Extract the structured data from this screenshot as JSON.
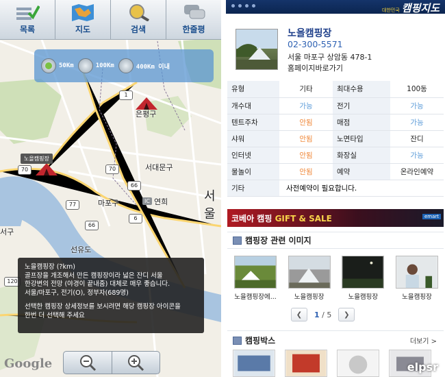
{
  "map_panel": {
    "toolbar": [
      {
        "label": "목록",
        "icon": "list-check-icon"
      },
      {
        "label": "지도",
        "icon": "map-icon"
      },
      {
        "label": "검색",
        "icon": "search-globe-icon"
      },
      {
        "label": "한줄평",
        "icon": "chat-bubbles-icon"
      }
    ],
    "radius_options": [
      {
        "label": "50Km",
        "selected": true
      },
      {
        "label": "100Km",
        "selected": false
      },
      {
        "label": "400Km 이내",
        "selected": false
      }
    ],
    "map_labels": {
      "eunpyeong": "은평구",
      "seodaemun": "서대문구",
      "mapo": "마포구",
      "yeonhui": "연희",
      "seoul": "서울",
      "seogu": "서구",
      "seonyu": "선유도",
      "ic": "IC",
      "road_1": "1",
      "road_70a": "70",
      "road_70b": "70",
      "road_66a": "66",
      "road_66b": "66",
      "road_77": "77",
      "road_6": "6",
      "road_120": "120"
    },
    "marker_tag": "노을캠핑장",
    "info_popup": {
      "line1": "노을캠핑장 (?km)\n골프장을 개조해서 만든 캠핑장이라 넓은 잔디 서울\n한강변의 전망 (야경이 끝내줌) 대체로 매우 좋습니다.\n서울/마포구, 전기(O), 정부자(689명)",
      "line2": "선택한 캠핑장 상세정보를 보시려면 해당 캠핑장 아이콘을\n한번 더 선택해 주세요"
    },
    "google_logo": "Google",
    "zoom": {
      "out_icon": "zoom-out-icon",
      "in_icon": "zoom-in-icon"
    }
  },
  "detail_panel": {
    "brand": {
      "small": "대한민국",
      "big": "캠핑지도"
    },
    "camp": {
      "name": "노을캠핑장",
      "phone": "02-300-5571",
      "address": "서울 마포구 상암동 478-1",
      "homepage": "홈페이지바로가기"
    },
    "facilities": [
      [
        {
          "k": "유형",
          "v": "기타",
          "c": "gray"
        },
        {
          "k": "최대수용",
          "v": "100동",
          "c": "gray"
        }
      ],
      [
        {
          "k": "개수대",
          "v": "가능",
          "c": "blue"
        },
        {
          "k": "전기",
          "v": "가능",
          "c": "blue"
        }
      ],
      [
        {
          "k": "텐트주차",
          "v": "안됨",
          "c": "orange"
        },
        {
          "k": "매점",
          "v": "가능",
          "c": "blue"
        }
      ],
      [
        {
          "k": "샤워",
          "v": "안됨",
          "c": "orange"
        },
        {
          "k": "노면타입",
          "v": "잔디",
          "c": "gray"
        }
      ],
      [
        {
          "k": "인터넷",
          "v": "안됨",
          "c": "orange"
        },
        {
          "k": "화장실",
          "v": "가능",
          "c": "blue"
        }
      ],
      [
        {
          "k": "물놀이",
          "v": "안됨",
          "c": "orange"
        },
        {
          "k": "예약",
          "v": "온라인예약",
          "c": "gray"
        }
      ]
    ],
    "etc": {
      "k": "기타",
      "v": "사전예약이 필요합니다."
    },
    "banner": {
      "title_red": "코베아 캠핑",
      "title_gold": "GIFT & SALE",
      "mart": "emart"
    },
    "images_section": {
      "title": "캠핑장 관련 이미지",
      "items": [
        {
          "caption": "노을캠핑장에..."
        },
        {
          "caption": "노을캠핑장"
        },
        {
          "caption": "노을캠핑장"
        },
        {
          "caption": "노을캠핑장"
        }
      ],
      "pager": {
        "current": "1",
        "total": "/ 5"
      }
    },
    "box_section": {
      "title": "캠핑박스",
      "more": "더보기 >"
    },
    "watermark": "elpsr"
  }
}
